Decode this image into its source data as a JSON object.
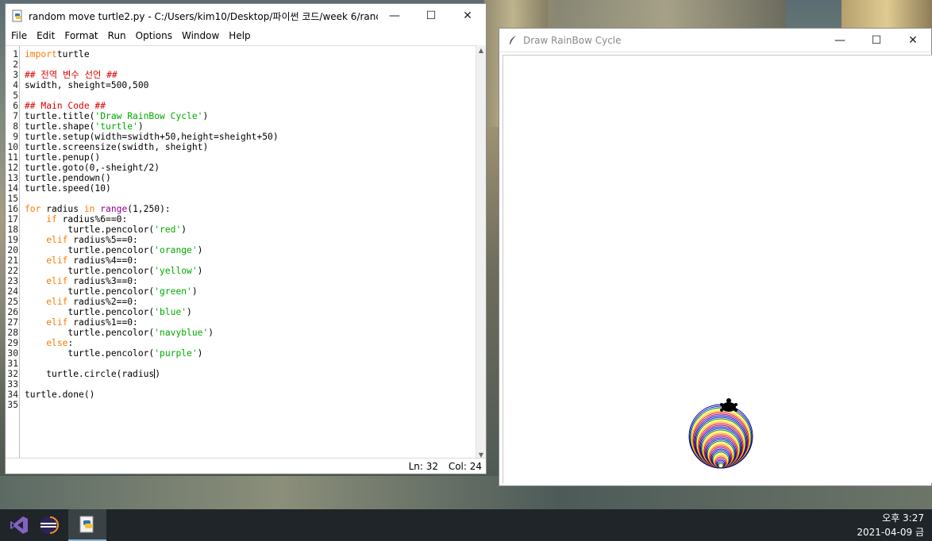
{
  "idle_window": {
    "title": "random move turtle2.py - C:/Users/kim10/Desktop/파이썬 코드/week 6/rando...",
    "buttons": {
      "minimize": "—",
      "maximize": "☐",
      "close": "✕"
    },
    "menu": [
      "File",
      "Edit",
      "Format",
      "Run",
      "Options",
      "Window",
      "Help"
    ],
    "status": {
      "line": "Ln: 32",
      "col": "Col: 24"
    }
  },
  "code_lines": [
    [
      [
        "kw",
        "import"
      ],
      [
        "",
        "turtle"
      ]
    ],
    [],
    [
      [
        "cm",
        "## 전역 변수 선언 ##"
      ]
    ],
    [
      [
        "",
        "swidth, sheight=500,500"
      ]
    ],
    [],
    [
      [
        "cm",
        "## Main Code ##"
      ]
    ],
    [
      [
        "",
        "turtle.title("
      ],
      [
        "st",
        "'Draw RainBow Cycle'"
      ],
      [
        "",
        ")"
      ]
    ],
    [
      [
        "",
        "turtle.shape("
      ],
      [
        "st",
        "'turtle'"
      ],
      [
        "",
        ")"
      ]
    ],
    [
      [
        "",
        "turtle.setup(width=swidth+50,height=sheight+50)"
      ]
    ],
    [
      [
        "",
        "turtle.screensize(swidth, sheight)"
      ]
    ],
    [
      [
        "",
        "turtle.penup()"
      ]
    ],
    [
      [
        "",
        "turtle.goto(0,-sheight/2)"
      ]
    ],
    [
      [
        "",
        "turtle.pendown()"
      ]
    ],
    [
      [
        "",
        "turtle.speed(10)"
      ]
    ],
    [],
    [
      [
        "kw",
        "for"
      ],
      [
        "",
        " radius "
      ],
      [
        "kw",
        "in"
      ],
      [
        "",
        " "
      ],
      [
        "bi",
        "range"
      ],
      [
        "",
        "(1,250):"
      ]
    ],
    [
      [
        "",
        "    "
      ],
      [
        "kw",
        "if"
      ],
      [
        "",
        " radius%6==0:"
      ]
    ],
    [
      [
        "",
        "        turtle.pencolor("
      ],
      [
        "st",
        "'red'"
      ],
      [
        "",
        ")"
      ]
    ],
    [
      [
        "",
        "    "
      ],
      [
        "kw",
        "elif"
      ],
      [
        "",
        " radius%5==0:"
      ]
    ],
    [
      [
        "",
        "        turtle.pencolor("
      ],
      [
        "st",
        "'orange'"
      ],
      [
        "",
        ")"
      ]
    ],
    [
      [
        "",
        "    "
      ],
      [
        "kw",
        "elif"
      ],
      [
        "",
        " radius%4==0:"
      ]
    ],
    [
      [
        "",
        "        turtle.pencolor("
      ],
      [
        "st",
        "'yellow'"
      ],
      [
        "",
        ")"
      ]
    ],
    [
      [
        "",
        "    "
      ],
      [
        "kw",
        "elif"
      ],
      [
        "",
        " radius%3==0:"
      ]
    ],
    [
      [
        "",
        "        turtle.pencolor("
      ],
      [
        "st",
        "'green'"
      ],
      [
        "",
        ")"
      ]
    ],
    [
      [
        "",
        "    "
      ],
      [
        "kw",
        "elif"
      ],
      [
        "",
        " radius%2==0:"
      ]
    ],
    [
      [
        "",
        "        turtle.pencolor("
      ],
      [
        "st",
        "'blue'"
      ],
      [
        "",
        ")"
      ]
    ],
    [
      [
        "",
        "    "
      ],
      [
        "kw",
        "elif"
      ],
      [
        "",
        " radius%1==0:"
      ]
    ],
    [
      [
        "",
        "        turtle.pencolor("
      ],
      [
        "st",
        "'navyblue'"
      ],
      [
        "",
        ")"
      ]
    ],
    [
      [
        "",
        "    "
      ],
      [
        "kw",
        "else"
      ],
      [
        "",
        ":"
      ]
    ],
    [
      [
        "",
        "        turtle.pencolor("
      ],
      [
        "st",
        "'purple'"
      ],
      [
        "",
        ")"
      ]
    ],
    [],
    [
      [
        "",
        "    turtle.circle(radius"
      ],
      [
        "caret",
        ""
      ],
      [
        "",
        ")"
      ]
    ],
    [],
    [
      [
        "",
        "turtle.done()"
      ]
    ],
    []
  ],
  "turtle_window": {
    "title": "Draw RainBow Cycle",
    "ring_colors": [
      "#ff0000",
      "#ffa500",
      "#ffff00",
      "#008000",
      "#0000ff",
      "#000080",
      "#800080"
    ]
  },
  "taskbar": {
    "apps": [
      "visual-studio",
      "eclipse",
      "python-idle"
    ],
    "time": "오후 3:27",
    "date": "2021-04-09 금"
  }
}
